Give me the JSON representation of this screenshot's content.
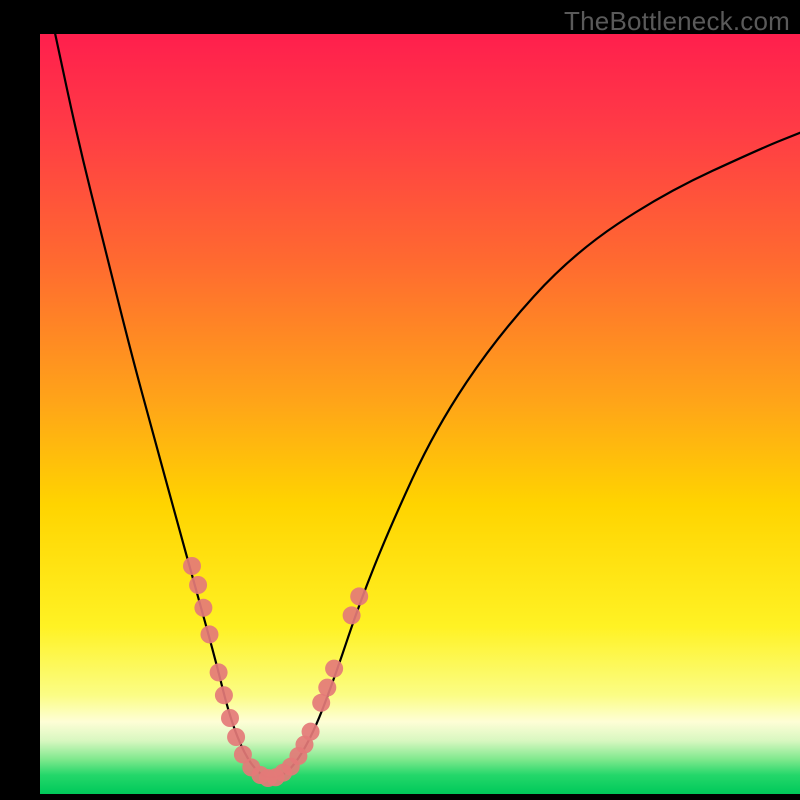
{
  "watermark": "TheBottleneck.com",
  "chart_data": {
    "type": "line",
    "title": "",
    "xlabel": "",
    "ylabel": "",
    "xlim": [
      0,
      100
    ],
    "ylim": [
      0,
      100
    ],
    "gradient_stops": [
      {
        "offset": 0.0,
        "color": "#ff1f4d"
      },
      {
        "offset": 0.12,
        "color": "#ff3a46"
      },
      {
        "offset": 0.3,
        "color": "#ff6a30"
      },
      {
        "offset": 0.48,
        "color": "#ffa319"
      },
      {
        "offset": 0.62,
        "color": "#ffd400"
      },
      {
        "offset": 0.78,
        "color": "#fff224"
      },
      {
        "offset": 0.87,
        "color": "#fbfd85"
      },
      {
        "offset": 0.905,
        "color": "#fefed6"
      },
      {
        "offset": 0.93,
        "color": "#d8f7c0"
      },
      {
        "offset": 0.955,
        "color": "#7de88c"
      },
      {
        "offset": 0.975,
        "color": "#24d76a"
      },
      {
        "offset": 1.0,
        "color": "#00c95a"
      }
    ],
    "series": [
      {
        "name": "bottleneck-curve",
        "x": [
          2.0,
          5.0,
          8.5,
          12.0,
          15.0,
          18.0,
          20.5,
          23.0,
          25.0,
          27.0,
          29.0,
          30.5,
          33.0,
          36.0,
          39.0,
          42.0,
          46.0,
          52.0,
          60.0,
          70.0,
          82.0,
          95.0,
          100.0
        ],
        "y": [
          100.0,
          86.0,
          72.0,
          58.0,
          47.0,
          36.0,
          27.0,
          18.0,
          10.0,
          5.0,
          2.5,
          2.0,
          3.0,
          8.0,
          16.0,
          25.0,
          35.0,
          48.0,
          60.0,
          71.0,
          79.0,
          85.0,
          87.0
        ]
      }
    ],
    "scatter": {
      "name": "sample-points",
      "color": "#e47a78",
      "points": [
        {
          "x": 20.0,
          "y": 30.0
        },
        {
          "x": 20.8,
          "y": 27.5
        },
        {
          "x": 21.5,
          "y": 24.5
        },
        {
          "x": 22.3,
          "y": 21.0
        },
        {
          "x": 23.5,
          "y": 16.0
        },
        {
          "x": 24.2,
          "y": 13.0
        },
        {
          "x": 25.0,
          "y": 10.0
        },
        {
          "x": 25.8,
          "y": 7.5
        },
        {
          "x": 26.7,
          "y": 5.2
        },
        {
          "x": 27.8,
          "y": 3.5
        },
        {
          "x": 29.0,
          "y": 2.5
        },
        {
          "x": 30.0,
          "y": 2.1
        },
        {
          "x": 31.0,
          "y": 2.2
        },
        {
          "x": 32.0,
          "y": 2.8
        },
        {
          "x": 33.0,
          "y": 3.6
        },
        {
          "x": 34.0,
          "y": 5.0
        },
        {
          "x": 34.8,
          "y": 6.5
        },
        {
          "x": 35.6,
          "y": 8.2
        },
        {
          "x": 37.0,
          "y": 12.0
        },
        {
          "x": 37.8,
          "y": 14.0
        },
        {
          "x": 38.7,
          "y": 16.5
        },
        {
          "x": 41.0,
          "y": 23.5
        },
        {
          "x": 42.0,
          "y": 26.0
        }
      ]
    }
  }
}
